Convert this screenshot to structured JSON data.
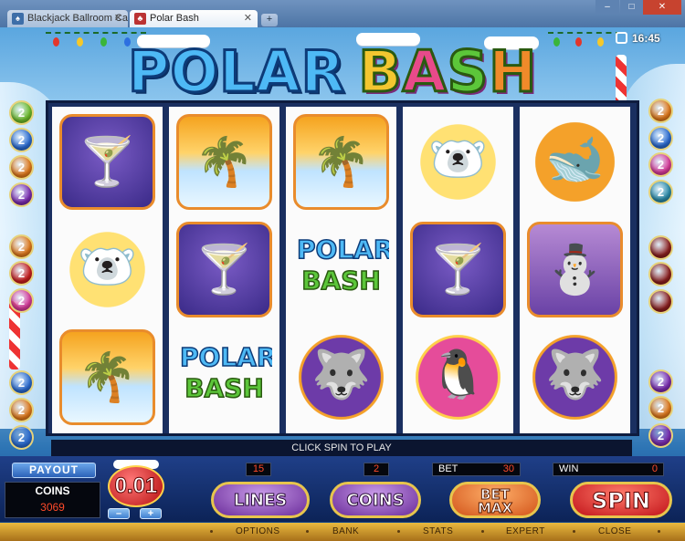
{
  "browser": {
    "tabs": [
      {
        "label": "Blackjack Ballroom Casino",
        "active": false
      },
      {
        "label": "Polar Bash",
        "active": true
      }
    ],
    "new_tab_label": "+",
    "window_controls": {
      "minimize": "–",
      "maximize": "□",
      "close": "✕"
    }
  },
  "game": {
    "title_word1": "POLAR",
    "title_word2_letters": [
      "B",
      "A",
      "S",
      "H"
    ],
    "clock": "16:45",
    "reels": [
      [
        {
          "symbol": "martini",
          "glyph": "🍸"
        },
        {
          "symbol": "polar-bear",
          "glyph": "🐻‍❄️"
        },
        {
          "symbol": "igloo",
          "glyph": "🌴"
        }
      ],
      [
        {
          "symbol": "igloo",
          "glyph": "🌴"
        },
        {
          "symbol": "martini",
          "glyph": "🍸"
        },
        {
          "symbol": "polar-bash-logo",
          "glyph": ""
        }
      ],
      [
        {
          "symbol": "igloo",
          "glyph": "🌴"
        },
        {
          "symbol": "polar-bash-logo",
          "glyph": ""
        },
        {
          "symbol": "husky",
          "glyph": "🐺"
        }
      ],
      [
        {
          "symbol": "polar-bear",
          "glyph": "🐻‍❄️"
        },
        {
          "symbol": "martini",
          "glyph": "🍸"
        },
        {
          "symbol": "penguin",
          "glyph": "🐧"
        }
      ],
      [
        {
          "symbol": "orca",
          "glyph": "🐋"
        },
        {
          "symbol": "snowman",
          "glyph": "⛄"
        },
        {
          "symbol": "husky",
          "glyph": "🐺"
        }
      ]
    ],
    "logo_symbol_text": {
      "line1": "POLAR",
      "line2": "BASH"
    },
    "paylines": {
      "left": [
        {
          "label": "2",
          "color": "#6dbb2a"
        },
        {
          "label": "2",
          "color": "#2a6ad0"
        },
        {
          "label": "2",
          "color": "#e2791a"
        },
        {
          "label": "2",
          "color": "#7b2bb0"
        },
        {
          "label": "2",
          "color": "#e2791a"
        },
        {
          "label": "2",
          "color": "#c81e1e"
        },
        {
          "label": "2",
          "color": "#d83a9a"
        },
        {
          "label": "2",
          "color": "#2a6ad0"
        },
        {
          "label": "2",
          "color": "#e2791a"
        },
        {
          "label": "2",
          "color": "#2a6ad0"
        }
      ],
      "right": [
        {
          "label": "2",
          "color": "#e2791a"
        },
        {
          "label": "2",
          "color": "#2a6ad0"
        },
        {
          "label": "2",
          "color": "#d83a9a"
        },
        {
          "label": "2",
          "color": "#2a8aa8"
        },
        {
          "label": "",
          "color": "#8a1e1e"
        },
        {
          "label": "",
          "color": "#8a1e1e"
        },
        {
          "label": "",
          "color": "#8a1e1e"
        },
        {
          "label": "2",
          "color": "#7b2bb0"
        },
        {
          "label": "2",
          "color": "#e2791a"
        },
        {
          "label": "2",
          "color": "#7b2bb0"
        }
      ]
    },
    "status_message": "CLICK SPIN TO PLAY"
  },
  "controls": {
    "payout_label": "PAYOUT",
    "coins_label": "COINS",
    "coins_value": "3069",
    "denomination": "0.01",
    "decrease_label": "–",
    "increase_label": "+",
    "lines_value": "15",
    "coins_per_line_value": "2",
    "bet_label": "BET",
    "bet_value": "30",
    "win_label": "WIN",
    "win_value": "0",
    "lines_button": "LINES",
    "coins_button": "COINS",
    "betmax_button_line1": "BET",
    "betmax_button_line2": "MAX",
    "spin_button": "SPIN"
  },
  "menu": [
    "OPTIONS",
    "BANK",
    "STATS",
    "EXPERT",
    "CLOSE"
  ]
}
